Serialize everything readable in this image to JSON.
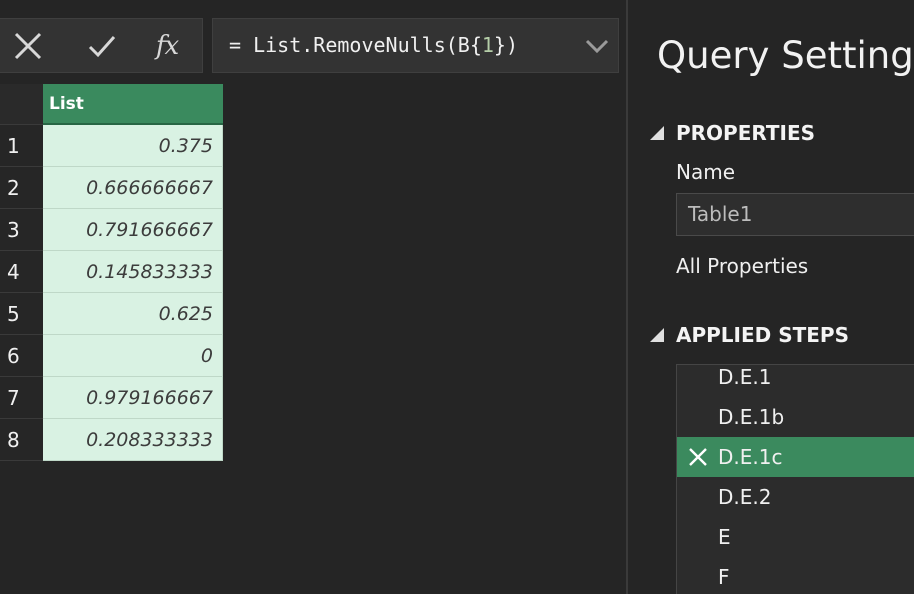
{
  "formula_bar": {
    "cancel_icon": "close-x-icon",
    "commit_icon": "checkmark-icon",
    "fx_label": "fx",
    "formula_prefix": "= List.RemoveNulls(B{",
    "formula_index": "1",
    "formula_suffix": "})",
    "expand_icon": "chevron-down-icon"
  },
  "grid": {
    "column_header": "List",
    "rows": [
      {
        "num": "1",
        "value": "0.375"
      },
      {
        "num": "2",
        "value": "0.666666667"
      },
      {
        "num": "3",
        "value": "0.791666667"
      },
      {
        "num": "4",
        "value": "0.145833333"
      },
      {
        "num": "5",
        "value": "0.625"
      },
      {
        "num": "6",
        "value": "0"
      },
      {
        "num": "7",
        "value": "0.979166667"
      },
      {
        "num": "8",
        "value": "0.208333333"
      }
    ]
  },
  "query_settings": {
    "title": "Query Settings",
    "properties_header": "PROPERTIES",
    "name_label": "Name",
    "name_value": "Table1",
    "all_properties": "All Properties",
    "applied_steps_header": "APPLIED STEPS",
    "steps": [
      {
        "label": "D.E.1"
      },
      {
        "label": "D.E.1b"
      },
      {
        "label": "D.E.1c",
        "selected": true
      },
      {
        "label": "D.E.2"
      },
      {
        "label": "E"
      },
      {
        "label": "F"
      }
    ]
  },
  "colors": {
    "accent_green": "#3a8a5e",
    "cell_fill": "#d9f2e3",
    "background": "#252525"
  }
}
